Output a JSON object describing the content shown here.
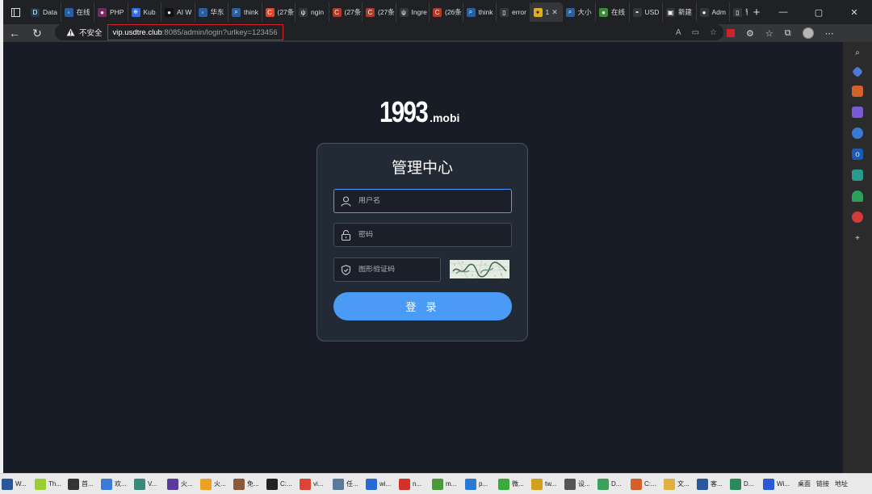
{
  "browser": {
    "tabs": [
      {
        "label": "Data",
        "color": "#1f3a4a",
        "glyph": "D"
      },
      {
        "label": "在线",
        "color": "#2a5e9e",
        "glyph": "◦"
      },
      {
        "label": "PHP",
        "color": "#7a2a5a",
        "glyph": "●"
      },
      {
        "label": "Kub",
        "color": "#326ce5",
        "glyph": "⎈"
      },
      {
        "label": "AI W",
        "color": "#111111",
        "glyph": "●"
      },
      {
        "label": "华东",
        "color": "#2a5e9e",
        "glyph": "◦"
      },
      {
        "label": "think",
        "color": "#2a5e9e",
        "glyph": "⌕"
      },
      {
        "label": "(27条",
        "color": "#e0452a",
        "glyph": "C"
      },
      {
        "label": "ngin",
        "color": "#35363a",
        "glyph": "ψ"
      },
      {
        "label": "(27条",
        "color": "#b0392a",
        "glyph": "C"
      },
      {
        "label": "(27条",
        "color": "#b0392a",
        "glyph": "C"
      },
      {
        "label": "Ingre",
        "color": "#35363a",
        "glyph": "ψ"
      },
      {
        "label": "(26条",
        "color": "#b0392a",
        "glyph": "C"
      },
      {
        "label": "think",
        "color": "#2a5e9e",
        "glyph": "⌕"
      },
      {
        "label": "error",
        "color": "#35363a",
        "glyph": "▯"
      }
    ],
    "active_tab": {
      "label": "1",
      "glyph": "✦"
    },
    "tabs_after": [
      {
        "label": "大小",
        "color": "#2a5e9e",
        "glyph": "⌕"
      },
      {
        "label": "在线",
        "color": "#3a8a3a",
        "glyph": "●"
      },
      {
        "label": "USD",
        "color": "#35363a",
        "glyph": "◓"
      },
      {
        "label": "新建",
        "color": "#35363a",
        "glyph": "▣"
      },
      {
        "label": "Adm",
        "color": "#35363a",
        "glyph": "●"
      },
      {
        "label": "管理",
        "color": "#35363a",
        "glyph": "▯"
      }
    ],
    "security_label": "不安全",
    "url_host": "vip.usdtre.club",
    "url_path": ":8085/admin/login?urlkey=123456"
  },
  "login": {
    "brand_big": "1993",
    "brand_small": ".mobi",
    "title": "管理中心",
    "username_placeholder": "用户名",
    "password_placeholder": "密码",
    "captcha_placeholder": "图形验证码",
    "submit_label": "登 录",
    "accent": "#4a9bf5"
  },
  "taskbar": {
    "items": [
      {
        "label": "W...",
        "color": "#2b579a"
      },
      {
        "label": "Th...",
        "color": "#9acd32"
      },
      {
        "label": "首...",
        "color": "#333333"
      },
      {
        "label": "欢...",
        "color": "#3a7bd5"
      },
      {
        "label": "V...",
        "color": "#3a8a7a"
      },
      {
        "label": "火...",
        "color": "#5a3a9a"
      },
      {
        "label": "火...",
        "color": "#f0a020"
      },
      {
        "label": "免...",
        "color": "#8a5a3a"
      },
      {
        "label": "C:...",
        "color": "#222222"
      },
      {
        "label": "vi...",
        "color": "#db4437"
      },
      {
        "label": "任...",
        "color": "#5a7a9a"
      },
      {
        "label": "wi...",
        "color": "#2a6ad5"
      },
      {
        "label": "n...",
        "color": "#d5302a"
      },
      {
        "label": "m...",
        "color": "#4a9a3a"
      },
      {
        "label": "p...",
        "color": "#2a7ad5"
      },
      {
        "label": "微...",
        "color": "#3aaa3a"
      },
      {
        "label": "tw...",
        "color": "#d5a020"
      },
      {
        "label": "设...",
        "color": "#555555"
      },
      {
        "label": "D...",
        "color": "#3aa05a"
      },
      {
        "label": "C:...",
        "color": "#d5602a"
      },
      {
        "label": "文...",
        "color": "#e0b040"
      },
      {
        "label": "客...",
        "color": "#2b579a"
      },
      {
        "label": "D...",
        "color": "#2a8a5a"
      },
      {
        "label": "Wi...",
        "color": "#2a5ad5"
      }
    ],
    "tray_desktop": "桌面",
    "tray_links": "链接",
    "tray_address": "地址"
  }
}
